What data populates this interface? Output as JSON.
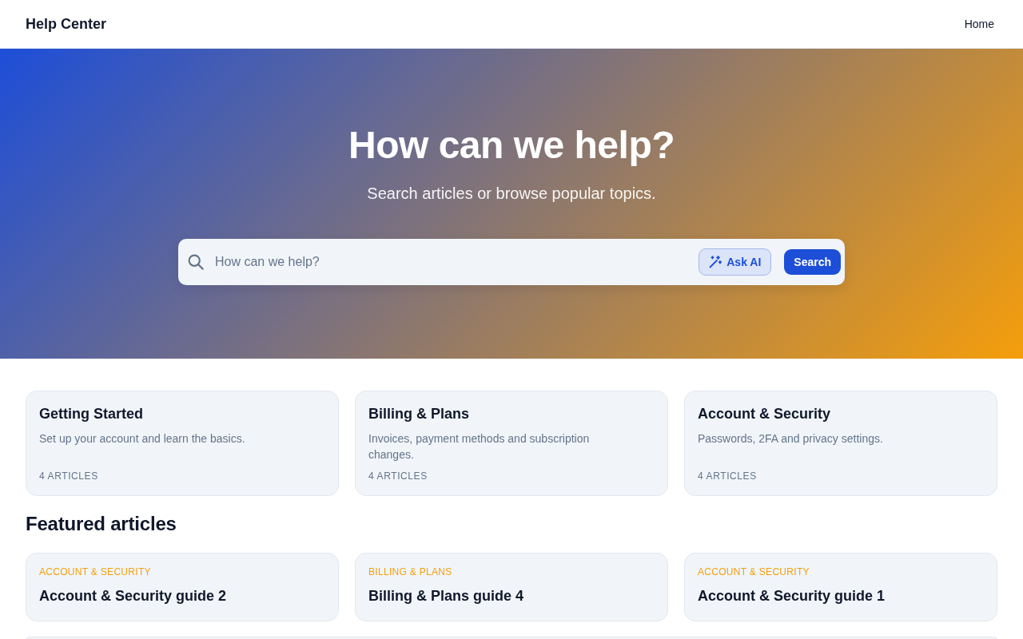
{
  "header": {
    "title": "Help Center",
    "nav": [
      {
        "label": "Home"
      }
    ]
  },
  "hero": {
    "title": "How can we help?",
    "subtitle": "Search articles or browse popular topics.",
    "search": {
      "placeholder": "How can we help?",
      "ask_ai": "Ask AI",
      "submit": "Search"
    }
  },
  "categories": [
    {
      "title": "Getting Started",
      "description": "Set up your account and learn the basics.",
      "count": "4 ARTICLES"
    },
    {
      "title": "Billing & Plans",
      "description": "Invoices, payment methods and subscription changes.",
      "count": "4 ARTICLES"
    },
    {
      "title": "Account & Security",
      "description": "Passwords, 2FA and privacy settings.",
      "count": "4 ARTICLES"
    }
  ],
  "featured": {
    "heading": "Featured articles",
    "articles": [
      {
        "category": "ACCOUNT & SECURITY",
        "title": "Account & Security guide 2"
      },
      {
        "category": "BILLING & PLANS",
        "title": "Billing & Plans guide 4"
      },
      {
        "category": "ACCOUNT & SECURITY",
        "title": "Account & Security guide 1"
      }
    ]
  }
}
